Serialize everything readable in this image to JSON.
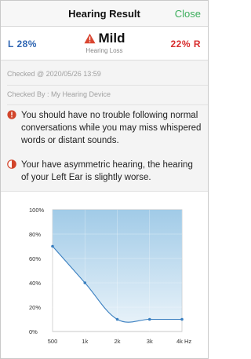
{
  "navbar": {
    "title": "Hearing Result",
    "close_label": "Close"
  },
  "summary": {
    "left_label": "L 28%",
    "right_label": "22% R",
    "severity": "Mild",
    "severity_sub": "Hearing Loss",
    "left_color": "#2f66b3",
    "right_color": "#d82e2e",
    "warning_icon": "warning-triangle-icon"
  },
  "info": {
    "checked_at": "Checked @ 2020/05/26 13:59",
    "checked_by": "Checked By : My Hearing Device",
    "note1": "You should have no trouble following normal conversations while you may miss whispered words or distant sounds.",
    "note2": "Your have asymmetric hearing, the hearing of your Left Ear is slightly worse.",
    "note1_icon": "alert-circle-icon",
    "note2_icon": "half-circle-icon",
    "note1_color": "#d2452b",
    "note2_color": "#d2452b"
  },
  "chart_data": {
    "type": "area",
    "categories": [
      "500",
      "1k",
      "2k",
      "3k",
      "4k"
    ],
    "x_tick_labels": [
      "500",
      "1k",
      "2k",
      "3k",
      "4k Hz"
    ],
    "y_tick_labels": [
      "0%",
      "20%",
      "40%",
      "60%",
      "80%",
      "100%"
    ],
    "ylim": [
      0,
      100
    ],
    "series": [
      {
        "values": [
          70,
          40,
          10,
          10,
          10
        ]
      }
    ],
    "fill_color": "#9cc8e6",
    "line_color": "#3a7fc0",
    "grid": true
  }
}
